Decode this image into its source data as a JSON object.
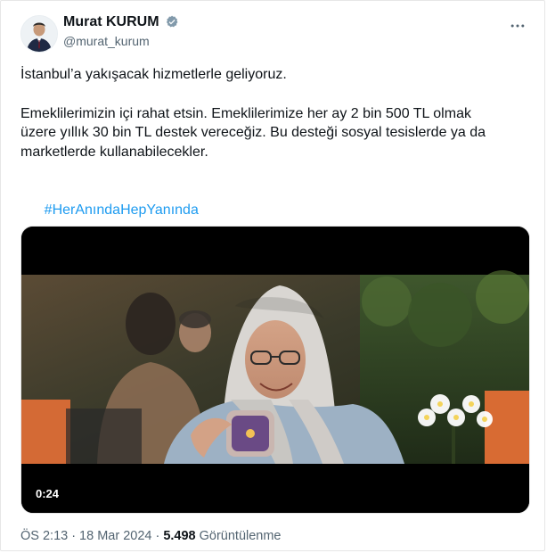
{
  "tweet": {
    "author": {
      "name": "Murat KURUM",
      "handle": "@murat_kurum",
      "verified": true
    },
    "text": {
      "line1": "İstanbul’a yakışacak hizmetlerle geliyoruz.",
      "line2": "Emeklilerimizin içi rahat etsin. Emeklilerimize her ay 2 bin 500 TL olmak\nüzere yıllık 30 bin TL destek vereceğiz. Bu desteği sosyal tesislerde ya da\nmarketlerde kullanabilecekler.",
      "hashtag": "#HerAnındaHepYanında"
    },
    "media": {
      "type": "video",
      "duration": "0:24"
    },
    "footer": {
      "time": "ÖS 2:13",
      "separator1": "·",
      "date": "18 Mar 2024",
      "separator2": "·",
      "views": "5.498",
      "views_label": "Görüntülenme"
    }
  },
  "icons": {
    "verified": "verified-badge-icon",
    "more": "more-horizontal-icon"
  },
  "colors": {
    "accent": "#1d9bf0",
    "text": "#0f1419",
    "muted": "#536471"
  }
}
